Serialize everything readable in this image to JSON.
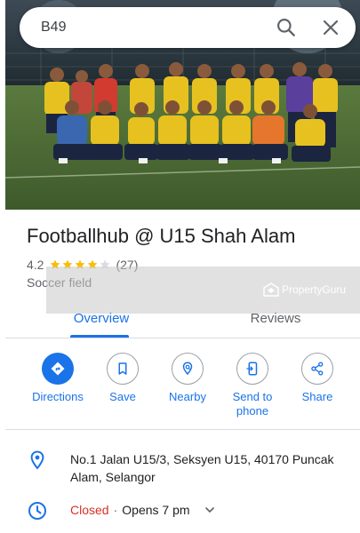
{
  "search": {
    "query": "B49"
  },
  "place": {
    "name": "Footballhub @ U15 Shah Alam",
    "rating": "4.2",
    "stars_filled": 4,
    "stars_total": 5,
    "review_count": "(27)",
    "category": "Soccer field"
  },
  "watermark": {
    "text": "PropertyGuru"
  },
  "tabs": [
    {
      "label": "Overview",
      "selected": true
    },
    {
      "label": "Reviews",
      "selected": false
    }
  ],
  "actions": [
    {
      "label": "Directions",
      "icon": "directions-icon"
    },
    {
      "label": "Save",
      "icon": "bookmark-icon"
    },
    {
      "label": "Nearby",
      "icon": "nearby-icon"
    },
    {
      "label": "Send to phone",
      "icon": "send-to-phone-icon"
    },
    {
      "label": "Share",
      "icon": "share-icon"
    }
  ],
  "info": {
    "address": "No.1 Jalan U15/3, Seksyen U15, 40170 Puncak Alam, Selangor",
    "hours_status": "Closed",
    "hours_separator": "·",
    "hours_detail": "Opens 7 pm"
  },
  "colors": {
    "accent": "#1a73e8",
    "closed": "#d93025",
    "star": "#fbbc04",
    "field": "#4f6b3a"
  }
}
